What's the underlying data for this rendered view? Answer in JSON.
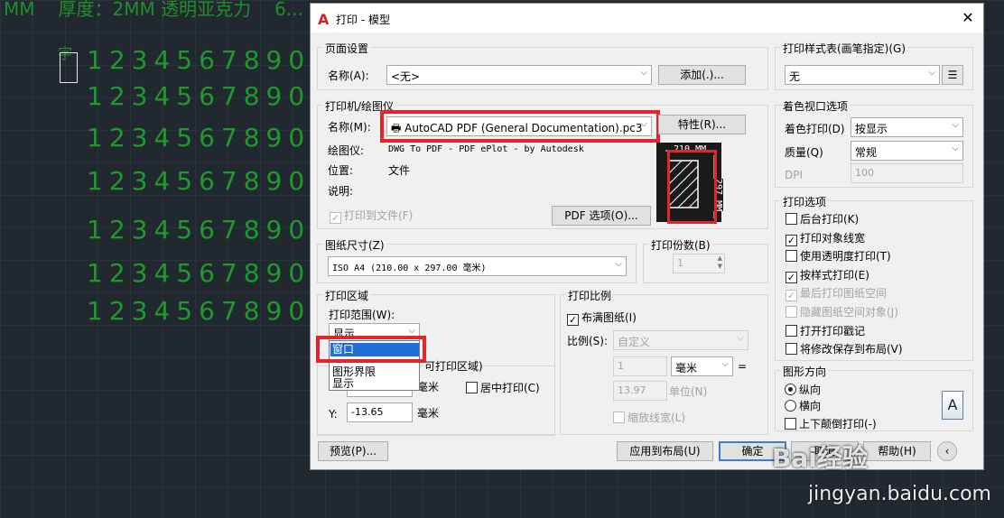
{
  "canvas": {
    "top_text": [
      "MM",
      "厚度：2MM 透明亚克力",
      "6..."
    ],
    "char": "字",
    "rows": [
      "1234567890",
      "1234567890",
      "1234567890",
      "1234567890",
      "1234567890",
      "1234567890",
      "1234567890"
    ]
  },
  "dialog": {
    "title": "打印 - 模型",
    "close_label": "✕",
    "page_setup": {
      "label": "页面设置",
      "name_label": "名称(A):",
      "name_value": "<无>",
      "add_button": "添加(.)..."
    },
    "printer": {
      "label": "打印机/绘图仪",
      "name_label": "名称(M):",
      "name_value": "AutoCAD PDF (General Documentation).pc3",
      "props_button": "特性(R)...",
      "plotter_label": "绘图仪:",
      "plotter_value": "DWG To PDF - PDF ePlot - by Autodesk",
      "location_label": "位置:",
      "location_value": "文件",
      "desc_label": "说明:",
      "print_to_file": "打印到文件(F)",
      "pdf_options_button": "PDF 选项(O)...",
      "preview_width": "210 MM",
      "preview_height": "297 MM"
    },
    "paper_size": {
      "label": "图纸尺寸(Z)",
      "value": "ISO A4 (210.00 x 297.00 毫米)"
    },
    "copies": {
      "label": "打印份数(B)",
      "value": "1"
    },
    "plot_area": {
      "label": "打印区域",
      "range_label": "打印范围(W):",
      "range_value": "显示",
      "options": [
        "窗口",
        "图形界限",
        "显示"
      ],
      "selected_option": "窗口"
    },
    "plot_offset": {
      "label_tail": "可打印区域)",
      "x_unit": "毫米",
      "center_label": "居中打印(C)",
      "y_label": "Y:",
      "y_value": "-13.65",
      "y_unit": "毫米"
    },
    "plot_scale": {
      "label": "打印比例",
      "fit_label": "布满图纸(I)",
      "scale_label": "比例(S):",
      "scale_value": "自定义",
      "value1": "1",
      "unit": "毫米",
      "equals": "=",
      "value2": "13.97",
      "unit2": "单位(N)",
      "lineweight_label": "缩放线宽(L)"
    },
    "style_table": {
      "label": "打印样式表(画笔指定)(G)",
      "value": "无"
    },
    "shaded_viewport": {
      "label": "着色视口选项",
      "shade_label": "着色打印(D)",
      "shade_value": "按显示",
      "quality_label": "质量(Q)",
      "quality_value": "常规",
      "dpi_label": "DPI",
      "dpi_value": "100"
    },
    "plot_options": {
      "label": "打印选项",
      "items": [
        {
          "label": "后台打印(K)",
          "checked": false,
          "disabled": false
        },
        {
          "label": "打印对象线宽",
          "checked": true,
          "disabled": false
        },
        {
          "label": "使用透明度打印(T)",
          "checked": false,
          "disabled": false
        },
        {
          "label": "按样式打印(E)",
          "checked": true,
          "disabled": false
        },
        {
          "label": "最后打印图纸空间",
          "checked": true,
          "disabled": true
        },
        {
          "label": "隐藏图纸空间对象(J)",
          "checked": false,
          "disabled": true
        },
        {
          "label": "打开打印戳记",
          "checked": false,
          "disabled": false
        },
        {
          "label": "将修改保存到布局(V)",
          "checked": false,
          "disabled": false
        }
      ]
    },
    "orientation": {
      "label": "图形方向",
      "portrait": "纵向",
      "landscape": "横向",
      "upside_down": "上下颠倒打印(-)",
      "icon_letter": "A"
    },
    "buttons": {
      "preview": "预览(P)...",
      "apply_layout": "应用到布局(U)",
      "ok": "确定",
      "cancel": "取消",
      "help": "帮助(H)",
      "more": "‹"
    }
  },
  "watermark": {
    "brand": "Bai经验",
    "url": "jingyan.baidu.com"
  },
  "colors": {
    "highlight": "#e3262e",
    "cad_text": "#1f9a2a",
    "selection": "#1e6fd6"
  }
}
